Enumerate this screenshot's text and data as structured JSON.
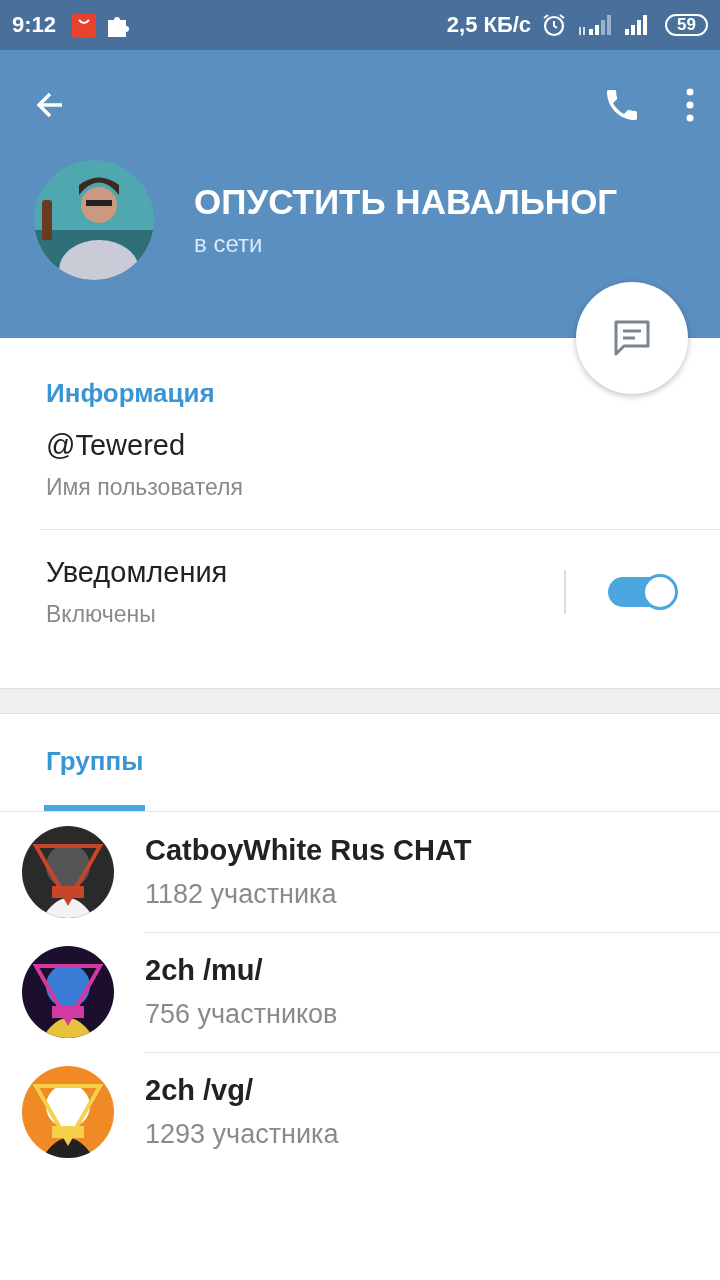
{
  "status_bar": {
    "time": "9:12",
    "speed": "2,5 КБ/с",
    "battery": "59"
  },
  "header": {
    "title": "ОПУСТИТЬ НАВАЛЬНОГ",
    "status": "в сети"
  },
  "info": {
    "heading": "Информация",
    "username": "@Tewered",
    "username_label": "Имя пользователя",
    "notifications": {
      "label": "Уведомления",
      "value": "Включены",
      "on": true
    }
  },
  "tabs": [
    {
      "label": "Группы",
      "selected": true
    }
  ],
  "groups": [
    {
      "name": "CatboyWhite Rus CHAT",
      "members": "1182 участника",
      "kind": "dark"
    },
    {
      "name": "2ch /mu/",
      "members": "756 участников",
      "kind": "neon"
    },
    {
      "name": "2ch /vg/",
      "members": "1293 участника",
      "kind": "orange"
    }
  ]
}
